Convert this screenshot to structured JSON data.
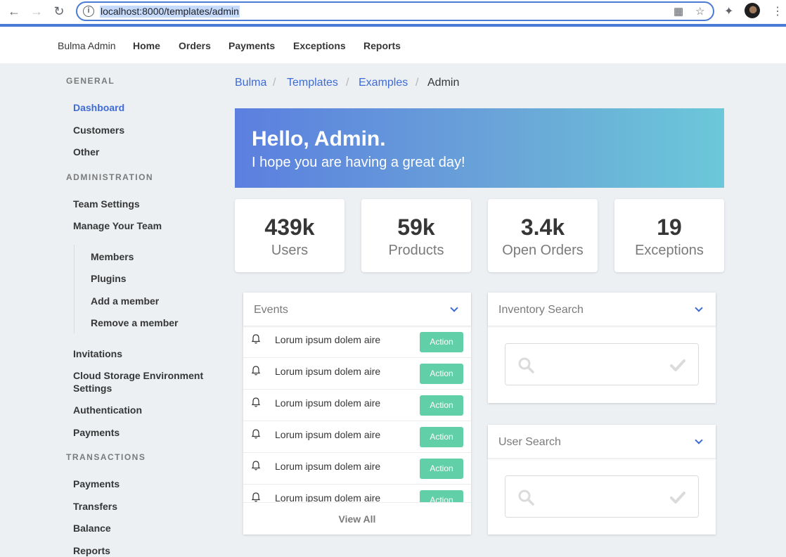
{
  "browser": {
    "url": "localhost:8000/templates/admin"
  },
  "navbar": {
    "brand": "Bulma Admin",
    "items": [
      "Home",
      "Orders",
      "Payments",
      "Exceptions",
      "Reports"
    ]
  },
  "sidebar": {
    "general_label": "GENERAL",
    "general": [
      "Dashboard",
      "Customers",
      "Other"
    ],
    "admin_label": "ADMINISTRATION",
    "admin": [
      "Team Settings",
      "Manage Your Team"
    ],
    "team_sub": [
      "Members",
      "Plugins",
      "Add a member",
      "Remove a member"
    ],
    "admin_more": [
      "Invitations",
      "Cloud Storage Environment Settings",
      "Authentication",
      "Payments"
    ],
    "transactions_label": "TRANSACTIONS",
    "transactions": [
      "Payments",
      "Transfers",
      "Balance",
      "Reports"
    ]
  },
  "breadcrumb": {
    "items": [
      "Bulma",
      "Templates",
      "Examples",
      "Admin"
    ],
    "separator": "/"
  },
  "hero": {
    "title": "Hello, Admin.",
    "subtitle": "I hope you are having a great day!"
  },
  "stats": [
    {
      "value": "439k",
      "label": "Users"
    },
    {
      "value": "59k",
      "label": "Products"
    },
    {
      "value": "3.4k",
      "label": "Open Orders"
    },
    {
      "value": "19",
      "label": "Exceptions"
    }
  ],
  "events": {
    "title": "Events",
    "rows": [
      {
        "text": "Lorum ipsum dolem aire",
        "action": "Action"
      },
      {
        "text": "Lorum ipsum dolem aire",
        "action": "Action"
      },
      {
        "text": "Lorum ipsum dolem aire",
        "action": "Action"
      },
      {
        "text": "Lorum ipsum dolem aire",
        "action": "Action"
      },
      {
        "text": "Lorum ipsum dolem aire",
        "action": "Action"
      },
      {
        "text": "Lorum ipsum dolem aire",
        "action": "Action"
      }
    ],
    "view_all": "View All"
  },
  "inventory_search": {
    "title": "Inventory Search",
    "value": ""
  },
  "user_search": {
    "title": "User Search",
    "value": ""
  },
  "colors": {
    "accent": "#3e6bd6",
    "action": "#61cfa8",
    "hero_start": "#5b7fdf",
    "hero_end": "#6bc8d9"
  }
}
